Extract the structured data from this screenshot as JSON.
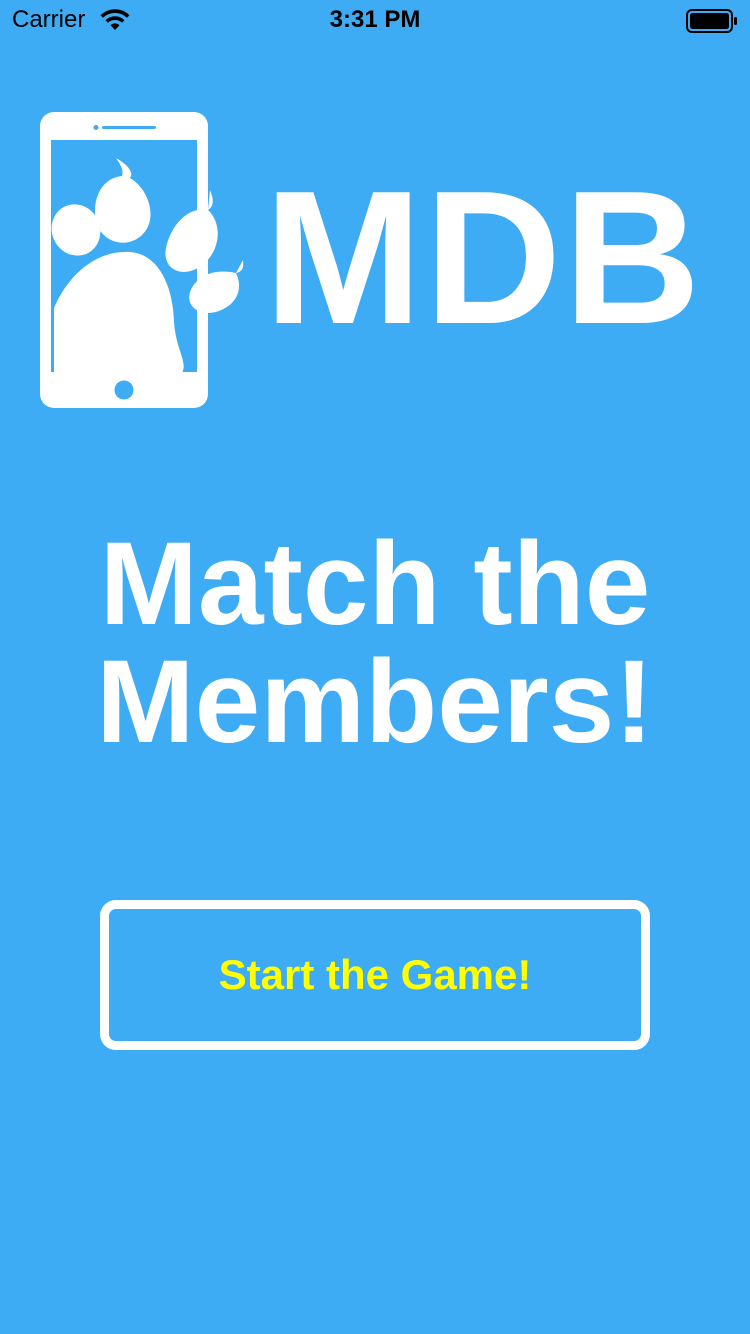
{
  "status_bar": {
    "carrier": "Carrier",
    "time": "3:31 PM",
    "icons": [
      "wifi-icon",
      "battery-icon"
    ]
  },
  "logo": {
    "text": "MDB",
    "icon": "phone-paw-icon"
  },
  "headline": {
    "line1": "Match the",
    "line2": "Members!"
  },
  "start_button": {
    "label": "Start the Game!"
  },
  "colors": {
    "background": "#3eabf5",
    "foreground": "#ffffff",
    "button_text": "#ffff00"
  }
}
